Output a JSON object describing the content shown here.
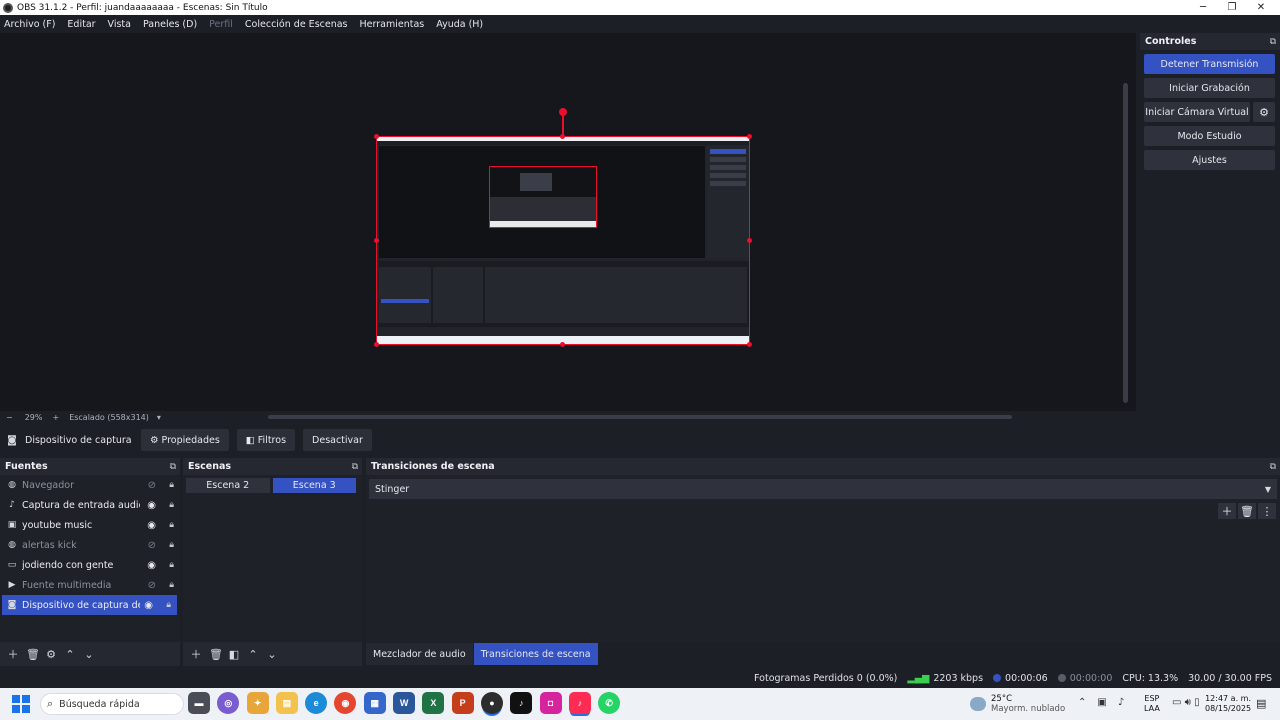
{
  "window": {
    "title": "OBS 31.1.2 - Perfil: juandaaaaaaaa - Escenas: Sin Título",
    "minimize_icon": "minimize-icon",
    "maximize_icon": "maximize-icon",
    "close_icon": "close-icon"
  },
  "menu": {
    "items": [
      "Archivo (F)",
      "Editar",
      "Vista",
      "Paneles (D)",
      "Perfil",
      "Colección de Escenas",
      "Herramientas",
      "Ayuda (H)"
    ],
    "disabled_index": 4
  },
  "zoom": {
    "minus": "−",
    "percent": "29%",
    "plus": "+",
    "scale_label": "Escalado (558x314)",
    "dropdown": "▾"
  },
  "source_toolbar": {
    "source_name": "Dispositivo de captura de v",
    "properties": "Propiedades",
    "filters": "Filtros",
    "deactivate": "Desactivar"
  },
  "controls": {
    "title": "Controles",
    "stop_stream": "Detener Transmisión",
    "start_recording": "Iniciar Grabación",
    "start_virtual_cam": "Iniciar Cámara Virtual",
    "studio_mode": "Modo Estudio",
    "settings": "Ajustes"
  },
  "sources": {
    "title": "Fuentes",
    "items": [
      {
        "label": "Navegador",
        "icon": "globe-icon",
        "visible": false
      },
      {
        "label": "Captura de entrada audio",
        "icon": "microphone-icon",
        "visible": true
      },
      {
        "label": "youtube music",
        "icon": "window-icon",
        "visible": true
      },
      {
        "label": "alertas kick",
        "icon": "globe-icon",
        "visible": false
      },
      {
        "label": "jodiendo con gente",
        "icon": "monitor-icon",
        "visible": true
      },
      {
        "label": "Fuente multimedia",
        "icon": "play-icon",
        "visible": false
      },
      {
        "label": "Dispositivo de captura de video",
        "icon": "camera-icon",
        "visible": true,
        "selected": true
      }
    ]
  },
  "scenes": {
    "title": "Escenas",
    "items": [
      {
        "label": "Escena 2",
        "active": false
      },
      {
        "label": "Escena 3",
        "active": true
      }
    ]
  },
  "transitions": {
    "title": "Transiciones de escena",
    "selected": "Stinger"
  },
  "tabs": {
    "mixer": "Mezclador de audio",
    "transitions": "Transiciones de escena"
  },
  "status": {
    "dropped_frames": "Fotogramas Perdidos 0 (0.0%)",
    "bitrate": "2203 kbps",
    "stream_time": "00:00:06",
    "rec_time": "00:00:00",
    "cpu": "CPU: 13.3%",
    "fps": "30.00 / 30.00 FPS",
    "live_color": "#3552c2"
  },
  "taskbar": {
    "search_placeholder": "Búsqueda rápida",
    "weather_temp": "25°C",
    "weather_desc": "Mayorm. nublado",
    "lang_1": "ESP",
    "lang_2": "LAA",
    "time": "12:47 a. m.",
    "date": "08/15/2025",
    "apps": [
      "file-explorer-icon",
      "copilot-icon",
      "folder-icon",
      "edge-icon",
      "chrome-icon",
      "store-icon",
      "word-icon",
      "excel-icon",
      "powerpoint-icon",
      "obs-icon",
      "tiktok-icon",
      "instagram-icon",
      "tiktok-live-icon",
      "whatsapp-icon"
    ]
  }
}
